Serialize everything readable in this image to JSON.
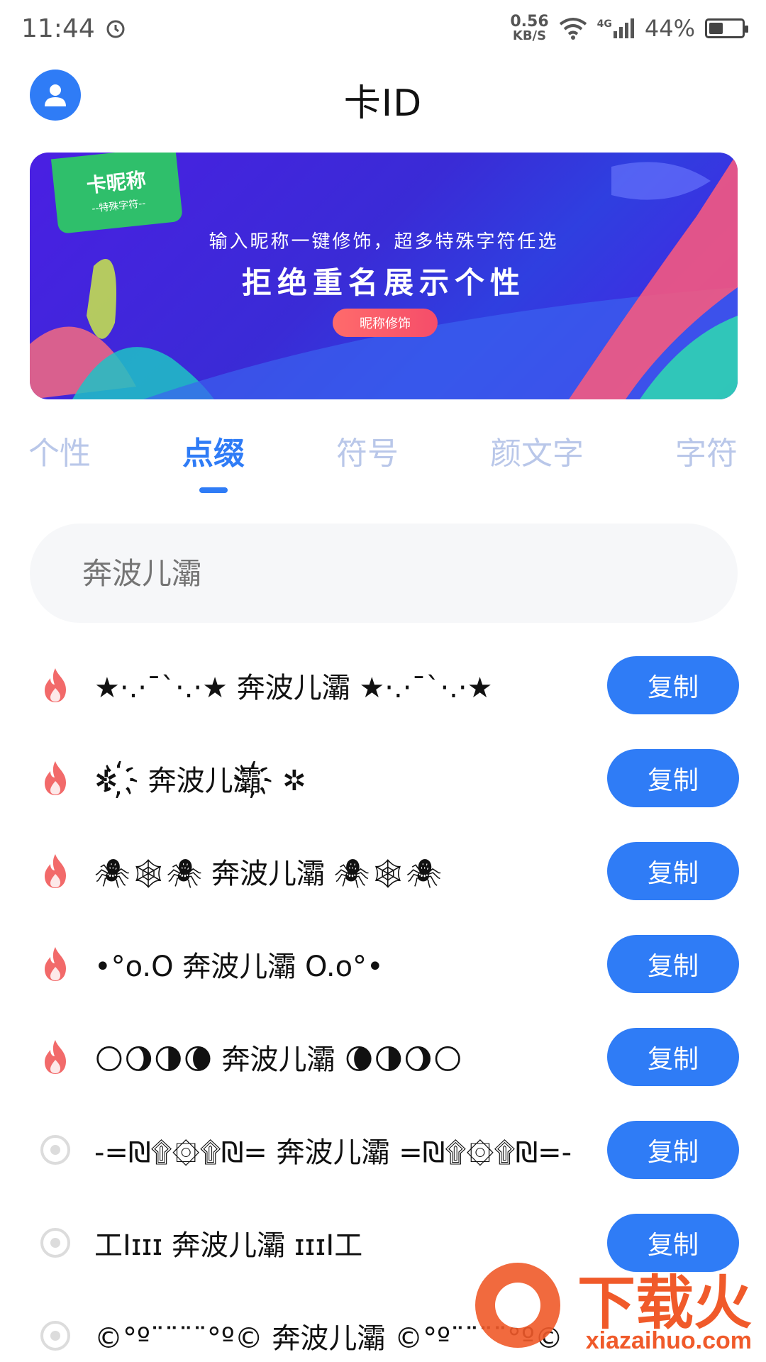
{
  "status_bar": {
    "time": "11:44",
    "net_speed_value": "0.56",
    "net_speed_unit": "KB/S",
    "network": "4G",
    "battery": "44%",
    "battery_level": 0.44
  },
  "header": {
    "title": "卡ID"
  },
  "banner": {
    "badge_title": "卡昵称",
    "badge_subtitle": "--特殊字符--",
    "subtitle": "输入昵称一键修饰，超多特殊字符任选",
    "headline": "拒绝重名展示个性",
    "button_label": "昵称修饰"
  },
  "tabs": [
    {
      "label": "个性"
    },
    {
      "label": "点缀"
    },
    {
      "label": "符号"
    },
    {
      "label": "颜文字"
    },
    {
      "label": "字符"
    }
  ],
  "active_tab": 1,
  "search": {
    "value": "",
    "placeholder": "奔波儿灞"
  },
  "list": [
    {
      "text": "★·.·¯`·.·★ 奔波儿灞 ★·.·¯`·.·★",
      "hot": true,
      "button": "复制"
    },
    {
      "text": "✲ ҉ 奔波儿灞҉   ✲",
      "hot": true,
      "button": "复制"
    },
    {
      "text": "🕷🕸🕷 奔波儿灞 🕷🕸🕷",
      "hot": true,
      "button": "复制"
    },
    {
      "text": "•°o.O 奔波儿灞 O.o°•",
      "hot": true,
      "button": "复制"
    },
    {
      "text": "🌕🌖🌗🌘 奔波儿灞 🌘🌗🌖🌕",
      "hot": true,
      "button": "复制"
    },
    {
      "text": "-=₪۩۞۩₪= 奔波儿灞 =₪۩۞۩₪=-",
      "hot": false,
      "button": "复制"
    },
    {
      "text": "工Iɪɪɪ 奔波儿灞 ɪɪɪI工",
      "hot": false,
      "button": "复制"
    },
    {
      "text": "©°º¨¨¨¨°º© 奔波儿灞 ©°º¨¨¨¨°º©",
      "hot": false,
      "button": "复制"
    }
  ],
  "watermark": {
    "title": "下载火",
    "domain": "xiazaihuo.com"
  },
  "colors": {
    "accent": "#2f7cf6",
    "tab_inactive": "#b9c7e9",
    "hot_icon": "#f26a6a",
    "watermark": "#f05a2a"
  }
}
